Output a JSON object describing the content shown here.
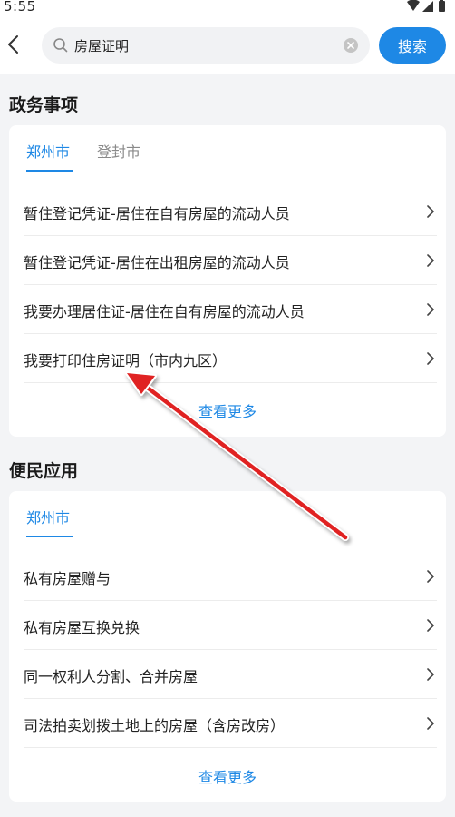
{
  "status": {
    "time": "5:55"
  },
  "search": {
    "value": "房屋证明",
    "button_label": "搜索"
  },
  "gov": {
    "title": "政务事项",
    "tabs": [
      "郑州市",
      "登封市"
    ],
    "items": [
      "暂住登记凭证-居住在自有房屋的流动人员",
      "暂住登记凭证-居住在出租房屋的流动人员",
      "我要办理居住证-居住在自有房屋的流动人员",
      "我要打印住房证明（市内九区）"
    ],
    "more": "查看更多"
  },
  "apps": {
    "title": "便民应用",
    "tabs": [
      "郑州市"
    ],
    "items": [
      "私有房屋赠与",
      "私有房屋互换兑换",
      "同一权利人分割、合并房屋",
      "司法拍卖划拨土地上的房屋（含房改房）"
    ],
    "more": "查看更多"
  },
  "colors": {
    "accent": "#1e88e5",
    "annotation_arrow": "#e02020"
  },
  "icons": [
    "wifi-icon",
    "signal-icon",
    "battery-icon",
    "back-arrow-icon",
    "search-icon",
    "clear-icon",
    "chevron-right-icon"
  ]
}
